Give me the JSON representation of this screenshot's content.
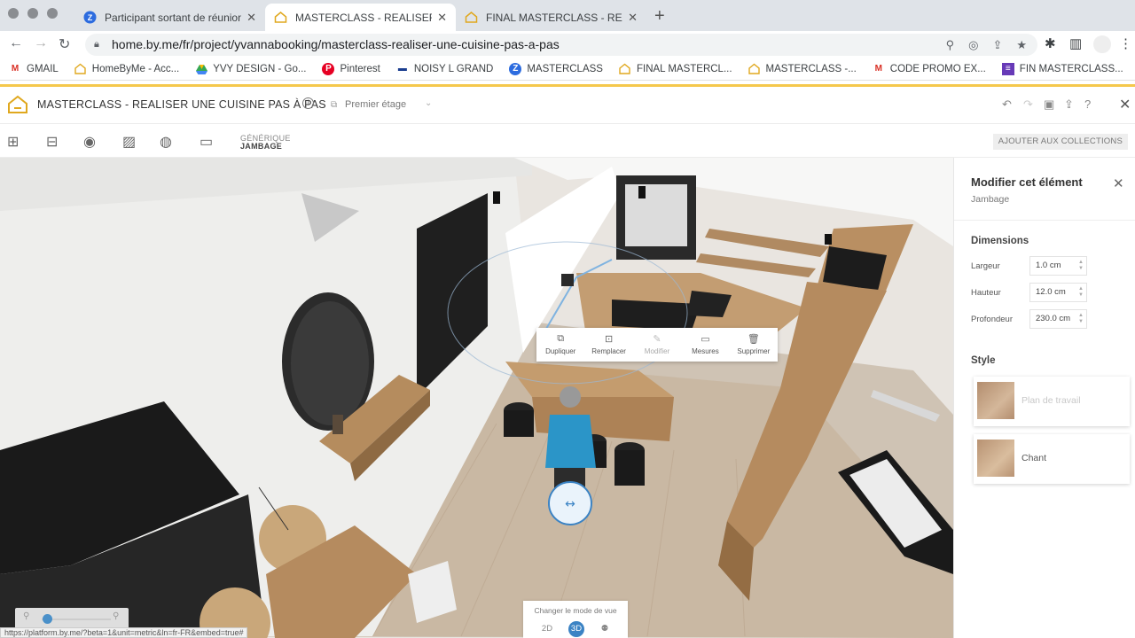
{
  "browser": {
    "tabs": [
      {
        "title": "Participant sortant de réunion ·",
        "favicon": "zoom-icon",
        "active": false
      },
      {
        "title": "MASTERCLASS - REALISER UNE",
        "favicon": "homebyme-icon",
        "active": true
      },
      {
        "title": "FINAL MASTERCLASS - REALIS",
        "favicon": "homebyme-icon",
        "active": false
      }
    ],
    "url": "home.by.me/fr/project/yvannabooking/masterclass-realiser-une-cuisine-pas-a-pas",
    "bookmarks": [
      {
        "label": "GMAIL",
        "icon": "gmail-icon"
      },
      {
        "label": "HomeByMe - Acc...",
        "icon": "homebyme-icon"
      },
      {
        "label": "YVY DESIGN - Go...",
        "icon": "drive-icon"
      },
      {
        "label": "Pinterest",
        "icon": "pinterest-icon"
      },
      {
        "label": "NOISY L GRAND",
        "icon": "car-icon"
      },
      {
        "label": "MASTERCLASS",
        "icon": "zoom-icon"
      },
      {
        "label": "FINAL MASTERCL...",
        "icon": "homebyme-icon"
      },
      {
        "label": "MASTERCLASS -...",
        "icon": "homebyme-icon"
      },
      {
        "label": "CODE PROMO EX...",
        "icon": "gmail-icon"
      },
      {
        "label": "FIN MASTERCLASS...",
        "icon": "form-icon"
      }
    ],
    "status_url": "https://platform.by.me/?beta=1&unit=metric&ln=fr-FR&embed=true#"
  },
  "app": {
    "title": "MASTERCLASS - REALISER UNE CUISINE PAS À PAS",
    "floor": "Premier étage",
    "breadcrumb_top": "GÉNÉRIQUE",
    "breadcrumb_bottom": "JAMBAGE",
    "add_to_collections": "AJOUTER AUX COLLECTIONS"
  },
  "context_menu": [
    {
      "label": "Dupliquer",
      "icon": "duplicate-icon",
      "disabled": false
    },
    {
      "label": "Remplacer",
      "icon": "replace-icon",
      "disabled": false
    },
    {
      "label": "Modifier",
      "icon": "edit-icon",
      "disabled": true
    },
    {
      "label": "Mesures",
      "icon": "ruler-icon",
      "disabled": false
    },
    {
      "label": "Supprimer",
      "icon": "trash-icon",
      "disabled": false
    }
  ],
  "view_mode": {
    "label": "Changer le mode de vue",
    "options": [
      "2D",
      "3D"
    ],
    "selected": "3D"
  },
  "zoom": {
    "level": 0.05
  },
  "panel": {
    "title": "Modifier cet élément",
    "subtitle": "Jambage",
    "dimensions_title": "Dimensions",
    "dimensions": [
      {
        "label": "Largeur",
        "value": "1.0 cm"
      },
      {
        "label": "Hauteur",
        "value": "12.0 cm"
      },
      {
        "label": "Profondeur",
        "value": "230.0 cm"
      }
    ],
    "style_title": "Style",
    "styles": [
      {
        "label": "Plan de travail",
        "swatch": "#b38d6e"
      },
      {
        "label": "Chant",
        "swatch": "#b89272"
      }
    ]
  },
  "colors": {
    "accent": "#f5c84c",
    "selection_blue": "#3b83c4"
  }
}
